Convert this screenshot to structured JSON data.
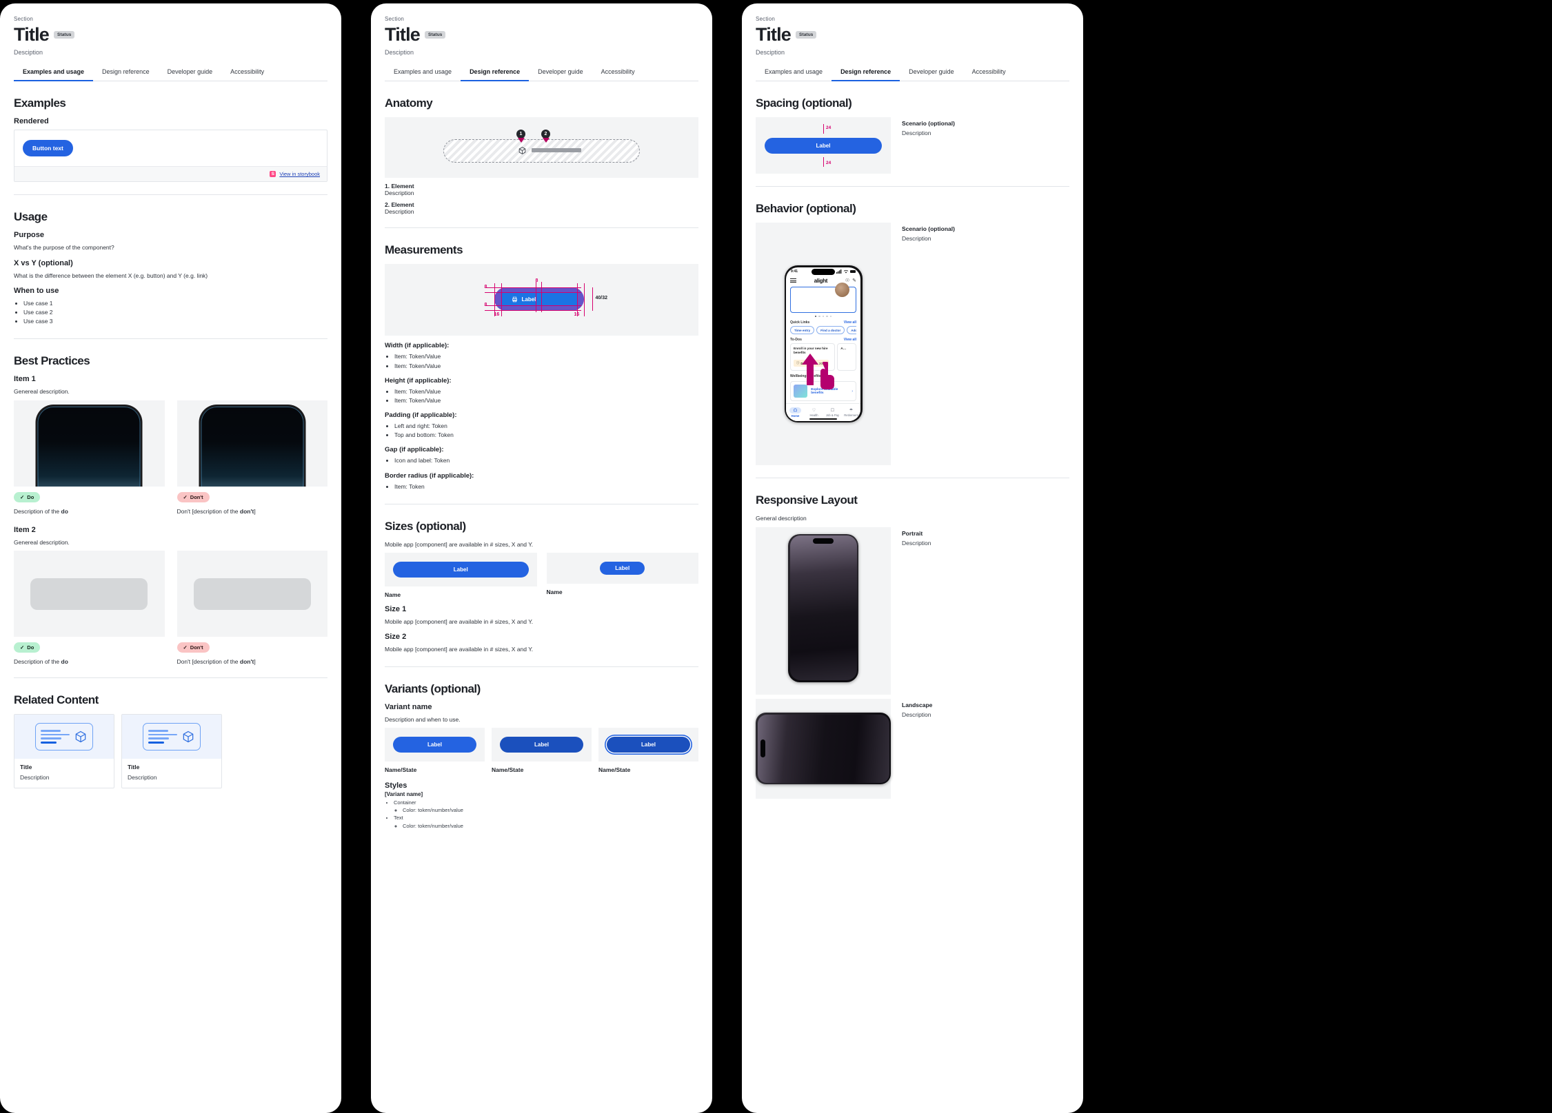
{
  "header": {
    "eyebrow": "Section",
    "title": "Title",
    "status": "Status",
    "description": "Desciption"
  },
  "tabs": [
    {
      "label": "Examples and usage"
    },
    {
      "label": "Design reference"
    },
    {
      "label": "Developer guide"
    },
    {
      "label": "Accessibility"
    }
  ],
  "panel1": {
    "examples": {
      "heading": "Examples",
      "rendered_heading": "Rendered",
      "button_label": "Button text",
      "storybook_icon": "storybook-icon",
      "storybook_link": "View in storybook"
    },
    "usage": {
      "heading": "Usage",
      "purpose_heading": "Purpose",
      "purpose_body": "What's the purpose of the component?",
      "xy_heading": "X vs Y (optional)",
      "xy_body": "What is the difference between the element X (e.g. button) and Y (e.g. link)",
      "when_heading": "When to use",
      "when_items": [
        "Use case 1",
        "Use case 2",
        "Use case 3"
      ]
    },
    "best_practices": {
      "heading": "Best Practices",
      "items": [
        {
          "title": "Item 1",
          "description": "Genereal description.",
          "do": {
            "badge": "Do",
            "caption_prefix": "Description of the ",
            "caption_bold": "do"
          },
          "dont": {
            "badge": "Don't",
            "caption_prefix": "Don't [description of the ",
            "caption_bold": "don't",
            "caption_suffix": "]"
          }
        },
        {
          "title": "Item 2",
          "description": "Genereal description.",
          "do": {
            "badge": "Do",
            "caption_prefix": "Description of the ",
            "caption_bold": "do"
          },
          "dont": {
            "badge": "Don't",
            "caption_prefix": "Don't [description of the ",
            "caption_bold": "don't",
            "caption_suffix": "]"
          }
        }
      ]
    },
    "related": {
      "heading": "Related Content",
      "cards": [
        {
          "title": "Title",
          "description": "Description"
        },
        {
          "title": "Title",
          "description": "Description"
        }
      ]
    }
  },
  "panel2": {
    "anatomy": {
      "heading": "Anatomy",
      "callouts": [
        "1",
        "2"
      ],
      "items": [
        {
          "num": "1.",
          "name": "Element",
          "description": "Description"
        },
        {
          "num": "2.",
          "name": "Element",
          "description": "Description"
        }
      ]
    },
    "measurements": {
      "heading": "Measurements",
      "diagram": {
        "label": "Label",
        "top": "8",
        "bottom": "8",
        "gap": "8",
        "left": "16",
        "right": "16",
        "height": "40/32"
      },
      "groups": [
        {
          "label": "Width (if applicable):",
          "items": [
            "Item: Token/Value",
            "Item: Token/Value"
          ]
        },
        {
          "label": "Height (if applicable):",
          "items": [
            "Item: Token/Value",
            "Item: Token/Value"
          ]
        },
        {
          "label": "Padding (if applicable):",
          "items": [
            "Left and right: Token",
            "Top and bottom: Token"
          ]
        },
        {
          "label": "Gap (if applicable):",
          "items": [
            "Icon and label: Token"
          ]
        },
        {
          "label": "Border radius (if applicable):",
          "items": [
            "Item: Token"
          ]
        }
      ]
    },
    "sizes": {
      "heading": "Sizes (optional)",
      "description": "Mobile app [component] are available in # sizes, X and Y.",
      "swatches": [
        {
          "button_label": "Label",
          "name": "Name"
        },
        {
          "button_label": "Label",
          "name": "Name"
        }
      ],
      "details": [
        {
          "title": "Size 1",
          "description": "Mobile app [component] are available in # sizes, X and Y."
        },
        {
          "title": "Size 2",
          "description": "Mobile app [component] are available in # sizes, X and Y."
        }
      ]
    },
    "variants": {
      "heading": "Variants (optional)",
      "variant_name": "Variant name",
      "variant_description": "Description and when to use.",
      "states": [
        {
          "button_label": "Label",
          "name": "Name/State"
        },
        {
          "button_label": "Label",
          "name": "Name/State"
        },
        {
          "button_label": "Label",
          "name": "Name/State"
        }
      ],
      "styles_heading": "Styles",
      "styles_variant": "[Variant name]",
      "styles_tree": [
        {
          "label": "Container",
          "children": [
            "Color: token/number/value"
          ]
        },
        {
          "label": "Text",
          "children": [
            "Color: token/number/value"
          ]
        }
      ]
    }
  },
  "panel3": {
    "spacing": {
      "heading": "Spacing (optional)",
      "button_label": "Label",
      "top_value": "24",
      "bottom_value": "24",
      "scenario_title": "Scenario (optional)",
      "scenario_description": "Description"
    },
    "behavior": {
      "heading": "Behavior (optional)",
      "scenario_title": "Scenario (optional)",
      "scenario_description": "Description",
      "phone": {
        "status_time": "9:41",
        "brand": "alight",
        "quick_links_title": "Quick Links",
        "quick_links_viewall": "View all",
        "chips": [
          "Time entry",
          "Find a doctor",
          "Add & review"
        ],
        "todos_title": "To-Dos",
        "todos_viewall": "View all",
        "todo_text": "Enroll in your new hire benefits",
        "todo_due_label": "Due",
        "todo_due_date": "Dec 14, 2023",
        "todo2_text": "A…",
        "wellbeing_title": "Wellbeing Benefits",
        "wellbeing_link": "Explore available benefits",
        "tabbar": [
          {
            "label": "Home",
            "icon": "home-icon"
          },
          {
            "label": "Health",
            "icon": "heart-icon"
          },
          {
            "label": "Job & Pay",
            "icon": "wallet-icon"
          },
          {
            "label": "Retirement",
            "icon": "umbrella-icon"
          }
        ]
      }
    },
    "responsive": {
      "heading": "Responsive Layout",
      "description": "General description",
      "items": [
        {
          "title": "Portrait",
          "description": "Description"
        },
        {
          "title": "Landscape",
          "description": "Description"
        }
      ]
    }
  },
  "colors": {
    "accent_blue": "#2463e1",
    "magenta": "#d6006e",
    "do_green": "#b8f0d0",
    "dont_red": "#fac4c4",
    "storybook_pink": "#ff4785"
  }
}
